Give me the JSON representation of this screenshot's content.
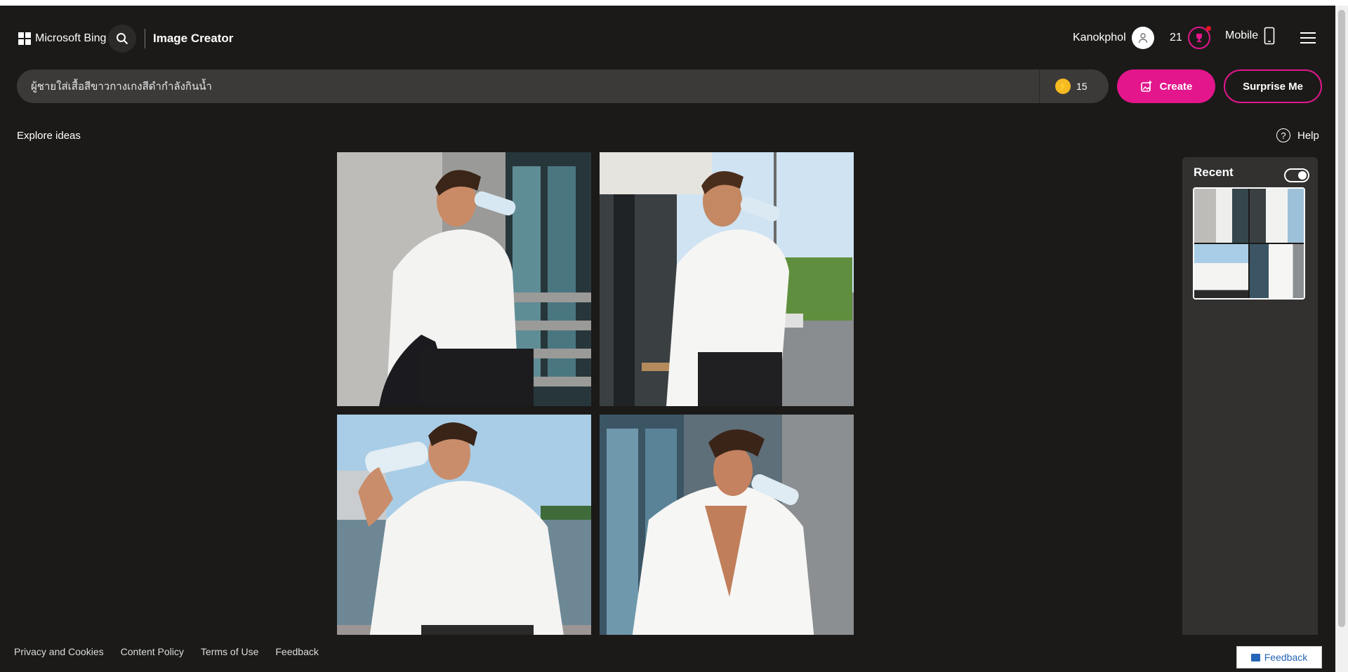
{
  "header": {
    "brand_name": "Microsoft Bing",
    "app_title": "Image Creator",
    "user_name": "Kanokphol",
    "rewards_points": "21",
    "mobile_label": "Mobile"
  },
  "prompt": {
    "value": "ผู้ชายใส่เสื้อสีขาวกางเกงสีดำกำลังกินน้ำ",
    "boosts": "15",
    "create_label": "Create",
    "surprise_label": "Surprise Me"
  },
  "page": {
    "explore_label": "Explore ideas",
    "help_label": "Help"
  },
  "recent": {
    "title": "Recent",
    "toggle_on": true
  },
  "footer": {
    "links": [
      "Privacy and Cookies",
      "Content Policy",
      "Terms of Use",
      "Feedback"
    ],
    "feedback_button": "Feedback"
  },
  "colors": {
    "accent": "#e3168c",
    "background": "#1b1a19",
    "panel": "#323130",
    "input": "#3b3a39"
  }
}
